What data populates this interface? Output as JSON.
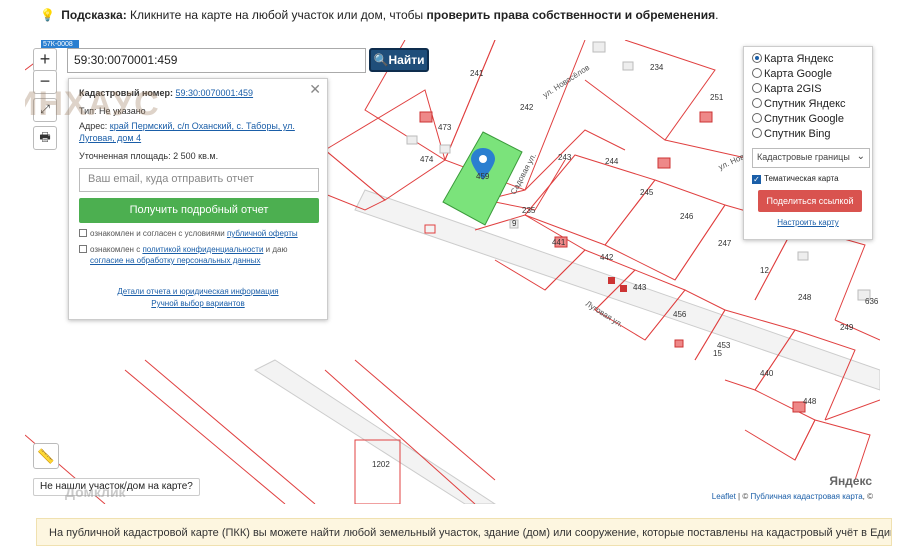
{
  "hint": {
    "label": "Подсказка:",
    "text": "Кликните на карте на любой участок или дом, чтобы",
    "bold": "проверить права собственности и обременения",
    "end": "."
  },
  "map": {
    "road_sign": "57К-0008",
    "search": {
      "value": "59:30:0070001:459",
      "button": "Найти"
    },
    "zoom": {
      "in": "+",
      "out": "−"
    },
    "watermark": "ИНХАУС",
    "popup": {
      "cadastral_label": "Кадастровый номер:",
      "cadastral_value": "59:30:0070001:459",
      "type_label": "Тип:",
      "type_value": "Не указано",
      "address_label": "Адрес:",
      "address_value": "край Пермский, с/п Оханский, с. Таборы, ул. Луговая, дом 4",
      "area_label": "Уточненная площадь:",
      "area_value": "2 500 кв.м.",
      "email_placeholder": "Ваш email, куда отправить отчет",
      "report_button": "Получить подробный отчет",
      "agree1_prefix": "ознакомлен и согласен с условиями",
      "agree1_link": "публичной оферты",
      "agree2_prefix": "ознакомлен с",
      "agree2_link1": "политикой конфиденциальности",
      "agree2_mid": "и даю",
      "agree2_link2": "согласие на обработку персональных данных",
      "link_details": "Детали отчета и юридическая информация",
      "link_manual": "Ручной выбор вариантов"
    },
    "layers": {
      "options": [
        {
          "label": "Карта Яндекс",
          "selected": true
        },
        {
          "label": "Карта Google",
          "selected": false
        },
        {
          "label": "Карта 2GIS",
          "selected": false
        },
        {
          "label": "Спутник Яндекс",
          "selected": false
        },
        {
          "label": "Спутник Google",
          "selected": false
        },
        {
          "label": "Спутник Bing",
          "selected": false
        }
      ],
      "select_value": "Кадастровые границы",
      "thematic": "Тематическая карта",
      "share_button": "Поделиться ссылкой",
      "settings_link": "Настроить карту"
    },
    "streets": {
      "novoselov": "ул. Новосёлов",
      "novo": "ул. Ново",
      "lugovaya": "Луговая ул.",
      "sadovaya": "Садовая ул."
    },
    "parcels": [
      "241",
      "242",
      "234",
      "251",
      "473",
      "474",
      "459",
      "243",
      "244",
      "245",
      "246",
      "247",
      "12",
      "248",
      "249",
      "235",
      "441",
      "442",
      "443",
      "456",
      "453",
      "15",
      "440",
      "448",
      "1202",
      "636",
      "9"
    ],
    "not_found": "Не нашли участок/дом на карте?",
    "yandex": "Яндекс",
    "domclick": "Домклик",
    "attribution": {
      "leaflet": "Leaflet",
      "sep": " | © ",
      "pkk": "Публичная кадастровая карта",
      "end": ", ©"
    }
  },
  "footer": {
    "text": "На публичной кадастровой карте (ПКК) вы можете найти любой земельный участок, здание (дом) или сооружение, которые поставлены на кадастровый учёт в Единый"
  },
  "colors": {
    "parcel_border": "#e04040",
    "selected_fill": "#7be37b",
    "search_btn": "#1f4e7a",
    "report_btn": "#4caf50",
    "share_btn": "#d9534f"
  }
}
